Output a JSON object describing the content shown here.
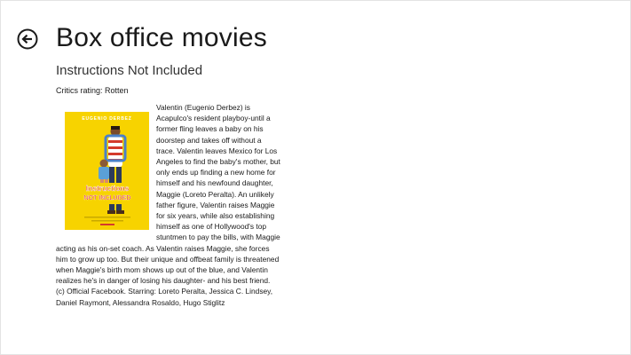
{
  "header": {
    "title": "Box office movies",
    "back_icon": "back-arrow-icon"
  },
  "movie": {
    "title": "Instructions Not Included",
    "rating_text": "Critics rating: Rotten",
    "poster": {
      "actor_name": "EUGENIO DERBEZ",
      "title_line1": "Instructions",
      "title_line2": "NOT INCLUDED",
      "background_color": "#f7d300"
    },
    "synopsis": "Valentin (Eugenio Derbez) is Acapulco's resident playboy-until a former fling leaves a baby on his doorstep and takes off without a trace. Valentin leaves Mexico for Los Angeles to find the baby's mother, but only ends up finding a new home for himself and his newfound daughter, Maggie (Loreto Peralta). An unlikely father figure, Valentin raises Maggie for six years, while also establishing himself as one of Hollywood's top stuntmen to pay the bills, with Maggie acting as his on-set coach. As Valentin raises Maggie, she forces him to grow up too. But their unique and offbeat family is threatened when Maggie's birth mom shows up out of the blue, and Valentin realizes he's in danger of losing his daughter- and his best friend. (c) Official Facebook. Starring: Loreto Peralta, Jessica C. Lindsey, Daniel Raymont, Alessandra Rosaldo, Hugo Stiglitz"
  }
}
